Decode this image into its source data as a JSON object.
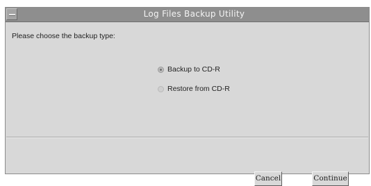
{
  "window": {
    "title": "Log Files Backup Utility"
  },
  "prompt": "Please choose the backup type:",
  "options": [
    {
      "label": "Backup to CD-R",
      "selected": true
    },
    {
      "label": "Restore from CD-R",
      "selected": false
    }
  ],
  "buttons": {
    "cancel": "Cancel",
    "continue": "Continue"
  }
}
